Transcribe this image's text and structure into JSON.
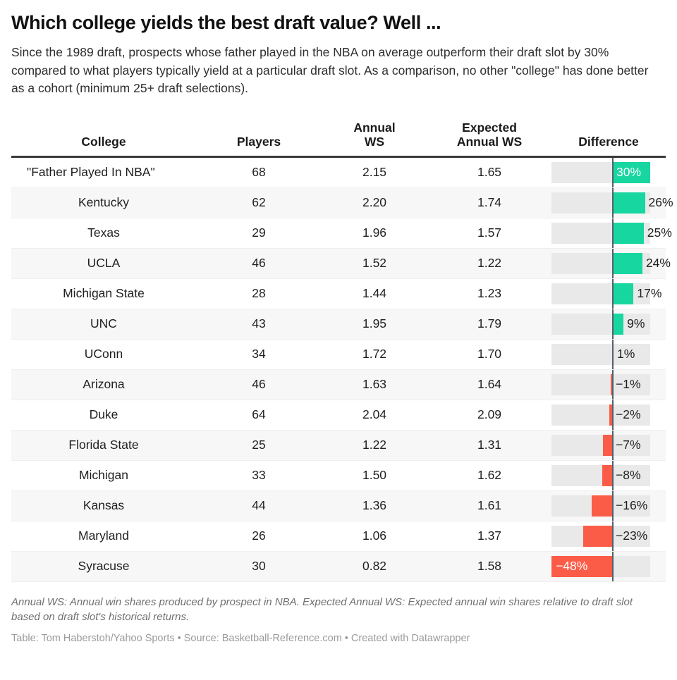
{
  "headline": "Which college yields the best draft value? Well ...",
  "subhead": "Since the 1989 draft, prospects whose father played in the NBA on average outperform their draft slot by 30% compared to what players typically yield at a particular draft slot. As a comparison, no other \"college\" has done better as a cohort (minimum 25+ draft selections).",
  "notes": "Annual WS: Annual win shares produced by prospect in NBA. Expected Annual WS: Expected annual win shares relative to draft slot based on draft slot's historical returns.",
  "credit": "Table: Tom Haberstoh/Yahoo Sports • Source: Basketball-Reference.com • Created with Datawrapper",
  "columns": {
    "college": "College",
    "players": "Players",
    "annual_ws_line1": "Annual",
    "annual_ws_line2": "WS",
    "expected_ws_line1": "Expected",
    "expected_ws_line2": "Annual WS",
    "difference": "Difference"
  },
  "colors": {
    "positive": "#17d6a0",
    "negative": "#fb5c47",
    "track": "#e9e9e9",
    "zero_line": "#55606b",
    "row_alt": "#f7f7f7",
    "header_rule": "#3a3a3a"
  },
  "chart_data": {
    "type": "table",
    "title": "Which college yields the best draft value? Well ...",
    "columns": [
      "College",
      "Players",
      "Annual WS",
      "Expected Annual WS",
      "Difference"
    ],
    "xlabel": "Difference (%)",
    "ylabel": "",
    "xlim": [
      -48,
      30
    ],
    "grid": false,
    "legend": "none",
    "rows": [
      {
        "college": "\"Father Played In NBA\"",
        "players": "68",
        "annual_ws": "2.15",
        "expected_ws": "1.65",
        "difference": 30,
        "difference_label": "30%",
        "label_inside": true
      },
      {
        "college": "Kentucky",
        "players": "62",
        "annual_ws": "2.20",
        "expected_ws": "1.74",
        "difference": 26,
        "difference_label": "26%",
        "label_inside": false
      },
      {
        "college": "Texas",
        "players": "29",
        "annual_ws": "1.96",
        "expected_ws": "1.57",
        "difference": 25,
        "difference_label": "25%",
        "label_inside": false
      },
      {
        "college": "UCLA",
        "players": "46",
        "annual_ws": "1.52",
        "expected_ws": "1.22",
        "difference": 24,
        "difference_label": "24%",
        "label_inside": false
      },
      {
        "college": "Michigan State",
        "players": "28",
        "annual_ws": "1.44",
        "expected_ws": "1.23",
        "difference": 17,
        "difference_label": "17%",
        "label_inside": false
      },
      {
        "college": "UNC",
        "players": "43",
        "annual_ws": "1.95",
        "expected_ws": "1.79",
        "difference": 9,
        "difference_label": "9%",
        "label_inside": false
      },
      {
        "college": "UConn",
        "players": "34",
        "annual_ws": "1.72",
        "expected_ws": "1.70",
        "difference": 1,
        "difference_label": "1%",
        "label_inside": false
      },
      {
        "college": "Arizona",
        "players": "46",
        "annual_ws": "1.63",
        "expected_ws": "1.64",
        "difference": -1,
        "difference_label": "−1%",
        "label_inside": false
      },
      {
        "college": "Duke",
        "players": "64",
        "annual_ws": "2.04",
        "expected_ws": "2.09",
        "difference": -2,
        "difference_label": "−2%",
        "label_inside": false
      },
      {
        "college": "Florida State",
        "players": "25",
        "annual_ws": "1.22",
        "expected_ws": "1.31",
        "difference": -7,
        "difference_label": "−7%",
        "label_inside": false
      },
      {
        "college": "Michigan",
        "players": "33",
        "annual_ws": "1.50",
        "expected_ws": "1.62",
        "difference": -8,
        "difference_label": "−8%",
        "label_inside": false
      },
      {
        "college": "Kansas",
        "players": "44",
        "annual_ws": "1.36",
        "expected_ws": "1.61",
        "difference": -16,
        "difference_label": "−16%",
        "label_inside": false
      },
      {
        "college": "Maryland",
        "players": "26",
        "annual_ws": "1.06",
        "expected_ws": "1.37",
        "difference": -23,
        "difference_label": "−23%",
        "label_inside": false
      },
      {
        "college": "Syracuse",
        "players": "30",
        "annual_ws": "0.82",
        "expected_ws": "1.58",
        "difference": -48,
        "difference_label": "−48%",
        "label_inside": true
      }
    ]
  }
}
